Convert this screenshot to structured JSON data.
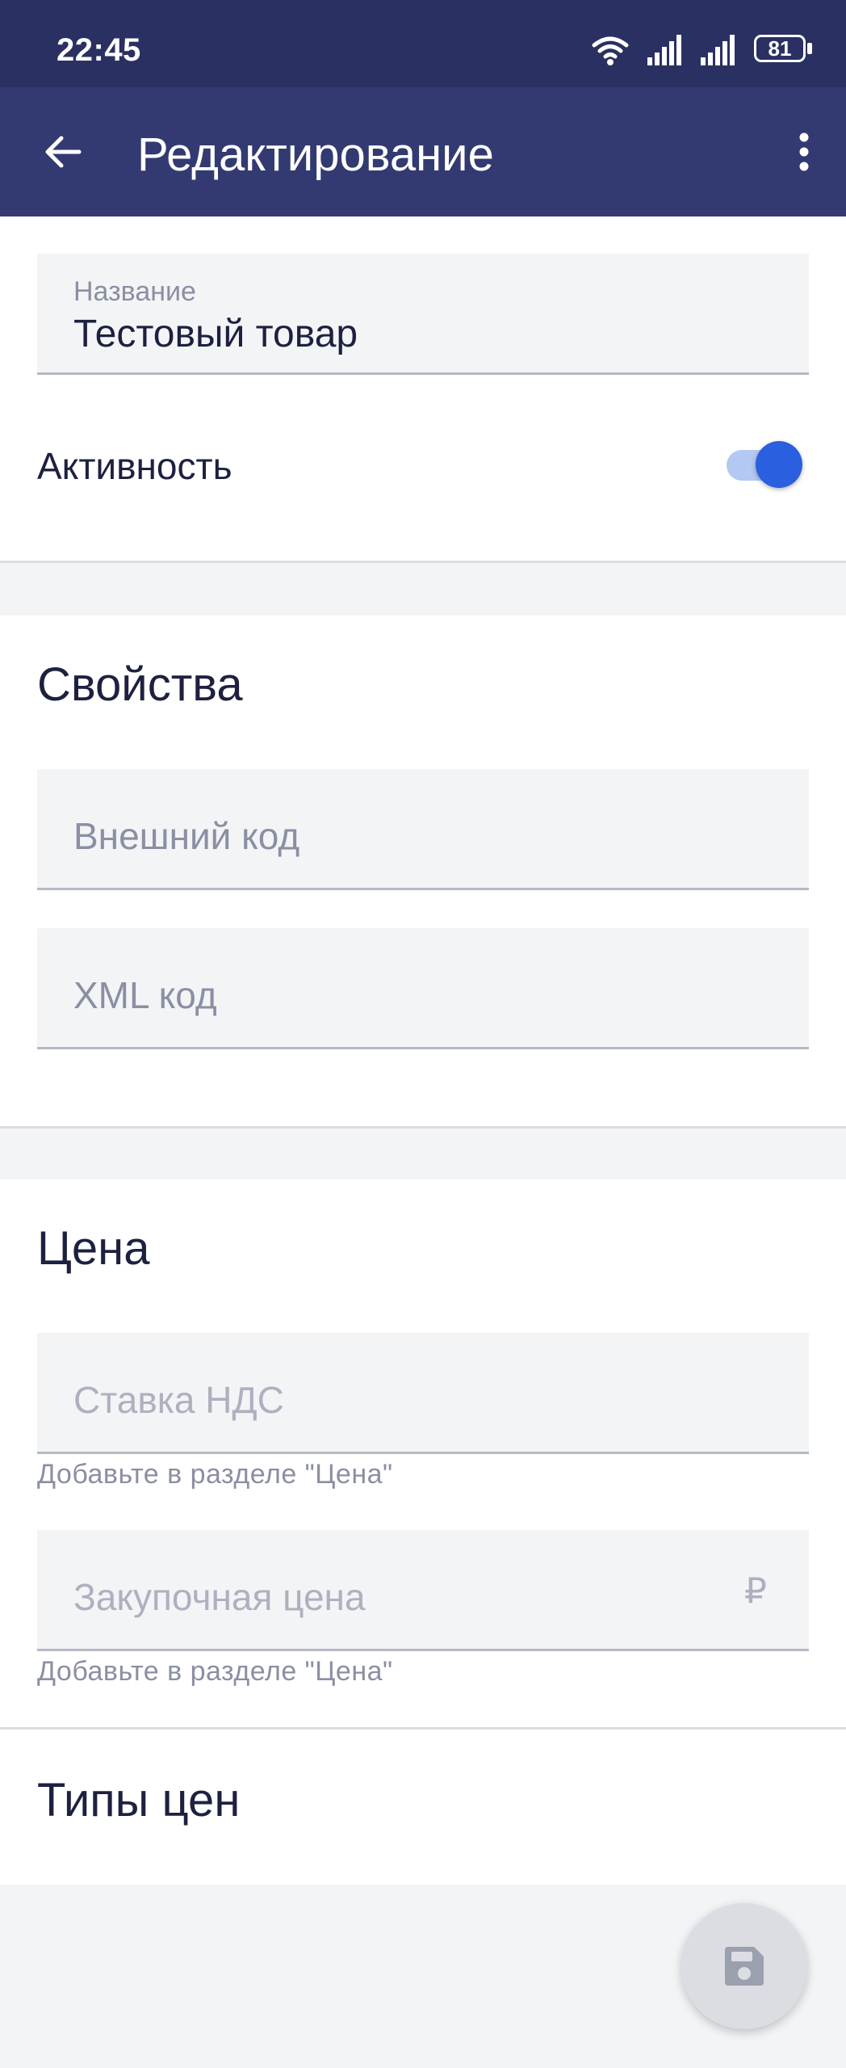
{
  "status_bar": {
    "time": "22:45",
    "battery": "81",
    "icons": [
      "wifi-icon",
      "signal-icon",
      "signal-icon",
      "battery-icon"
    ]
  },
  "app_bar": {
    "title": "Редактирование",
    "back_icon": "arrow-left-icon",
    "menu_icon": "more-vertical-icon"
  },
  "general": {
    "name_label": "Название",
    "name_value": "Тестовый товар",
    "active_label": "Активность",
    "active": true
  },
  "properties": {
    "title": "Свойства",
    "external_code_placeholder": "Внешний код",
    "xml_code_placeholder": "XML код"
  },
  "price": {
    "title": "Цена",
    "vat_placeholder": "Ставка НДС",
    "vat_hint": "Добавьте в разделе \"Цена\"",
    "purchase_placeholder": "Закупочная цена",
    "purchase_suffix": "₽",
    "purchase_hint": "Добавьте в разделе \"Цена\""
  },
  "price_types": {
    "title": "Типы цен"
  },
  "fab": {
    "icon": "save-icon"
  },
  "colors": {
    "status_bar": "#2b3062",
    "app_bar": "#333a72",
    "accent": "#2a5fe0"
  }
}
